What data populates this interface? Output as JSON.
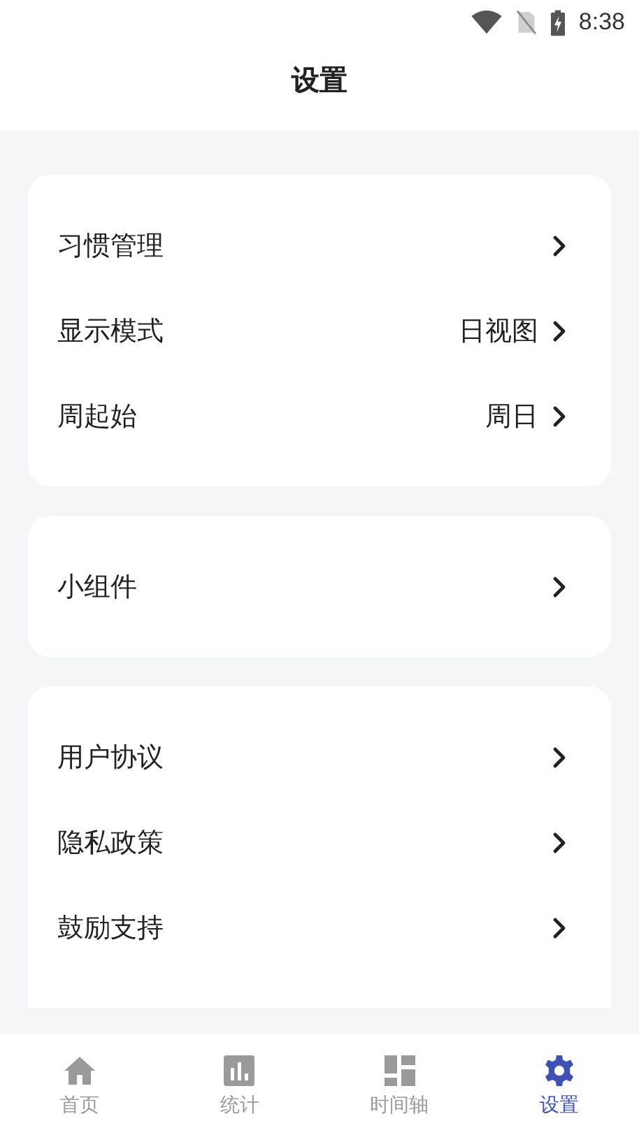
{
  "status_bar": {
    "time": "8:38"
  },
  "header": {
    "title": "设置"
  },
  "groups": [
    {
      "items": [
        {
          "label": "习惯管理"
        },
        {
          "label": "显示模式",
          "value": "日视图"
        },
        {
          "label": "周起始",
          "value": "周日"
        }
      ]
    },
    {
      "items": [
        {
          "label": "小组件"
        }
      ]
    },
    {
      "items": [
        {
          "label": "用户协议"
        },
        {
          "label": "隐私政策"
        },
        {
          "label": "鼓励支持"
        }
      ]
    }
  ],
  "tabs": [
    {
      "kind": "home",
      "label": "首页",
      "selected": false
    },
    {
      "kind": "stats",
      "label": "统计",
      "selected": false
    },
    {
      "kind": "timeline",
      "label": "时间轴",
      "selected": false
    },
    {
      "kind": "settings",
      "label": "设置",
      "selected": true
    }
  ]
}
